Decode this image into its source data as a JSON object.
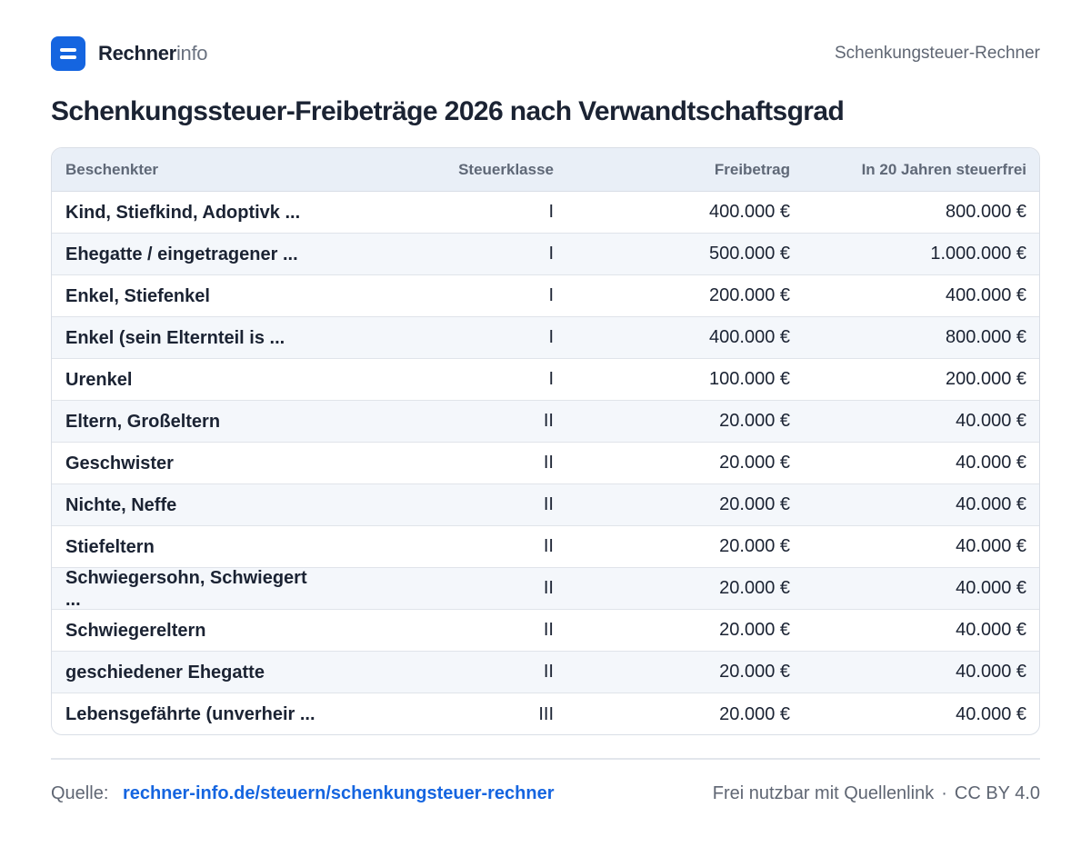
{
  "header": {
    "brand_strong": "Rechner",
    "brand_light": "info",
    "page_label": "Schenkungsteuer-Rechner"
  },
  "title": "Schenkungssteuer-Freibeträge 2026 nach Verwandtschaftsgrad",
  "table": {
    "columns": [
      "Beschenkter",
      "Steuerklasse",
      "Freibetrag",
      "In 20 Jahren steuerfrei"
    ],
    "rows": [
      {
        "name": "Kind, Stiefkind, Adoptivk ...",
        "klasse": "I",
        "freibetrag": "400.000 €",
        "zwanzig": "800.000 €"
      },
      {
        "name": "Ehegatte / eingetragener ...",
        "klasse": "I",
        "freibetrag": "500.000 €",
        "zwanzig": "1.000.000 €"
      },
      {
        "name": "Enkel, Stiefenkel",
        "klasse": "I",
        "freibetrag": "200.000 €",
        "zwanzig": "400.000 €"
      },
      {
        "name": "Enkel (sein Elternteil is ...",
        "klasse": "I",
        "freibetrag": "400.000 €",
        "zwanzig": "800.000 €"
      },
      {
        "name": "Urenkel",
        "klasse": "I",
        "freibetrag": "100.000 €",
        "zwanzig": "200.000 €"
      },
      {
        "name": "Eltern, Großeltern",
        "klasse": "II",
        "freibetrag": "20.000 €",
        "zwanzig": "40.000 €"
      },
      {
        "name": "Geschwister",
        "klasse": "II",
        "freibetrag": "20.000 €",
        "zwanzig": "40.000 €"
      },
      {
        "name": "Nichte, Neffe",
        "klasse": "II",
        "freibetrag": "20.000 €",
        "zwanzig": "40.000 €"
      },
      {
        "name": "Stiefeltern",
        "klasse": "II",
        "freibetrag": "20.000 €",
        "zwanzig": "40.000 €"
      },
      {
        "name": "Schwiegersohn, Schwiegert ...",
        "klasse": "II",
        "freibetrag": "20.000 €",
        "zwanzig": "40.000 €"
      },
      {
        "name": "Schwiegereltern",
        "klasse": "II",
        "freibetrag": "20.000 €",
        "zwanzig": "40.000 €"
      },
      {
        "name": "geschiedener Ehegatte",
        "klasse": "II",
        "freibetrag": "20.000 €",
        "zwanzig": "40.000 €"
      },
      {
        "name": "Lebensgefährte (unverheir ...",
        "klasse": "III",
        "freibetrag": "20.000 €",
        "zwanzig": "40.000 €"
      }
    ]
  },
  "footer": {
    "source_label": "Quelle:",
    "source_link": "rechner-info.de/steuern/schenkungsteuer-rechner",
    "license_text": "Frei nutzbar mit Quellenlink",
    "separator": "·",
    "license_name": "CC BY 4.0"
  }
}
